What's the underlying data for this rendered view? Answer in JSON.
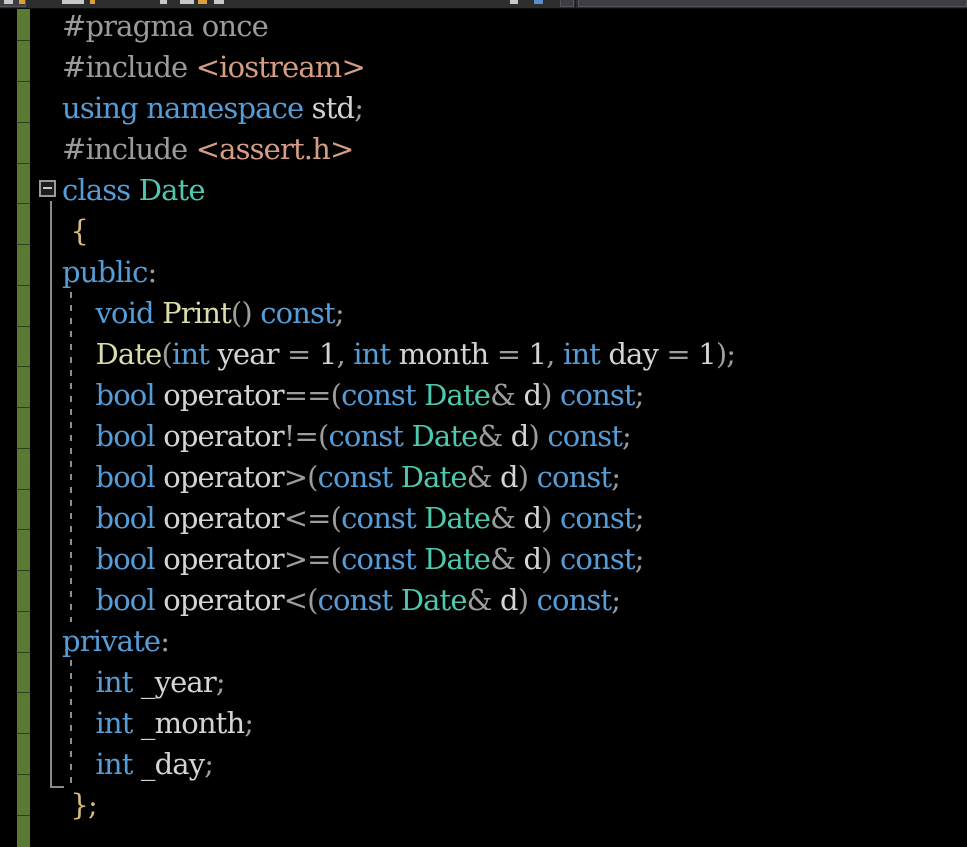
{
  "app": {
    "kind": "code-editor",
    "language": "C++",
    "theme": "dark"
  },
  "colors": {
    "background": "#000000",
    "toolbar": "#2d2d30",
    "change_bar_saved": "#5a7a34",
    "outline_marker": "#9a9a9a",
    "indent_guide": "#8f8f8f",
    "preprocessor": "#9b9b9b",
    "include_path": "#d69d85",
    "keyword": "#569cd6",
    "class_name": "#4ec9b0",
    "function_name": "#dcdcaa",
    "identifier": "#d4d4d4",
    "brace": "#d7ba7d",
    "punctuation": "#9d9d9d",
    "number": "#b5cea8"
  },
  "toolbar": {
    "visible": true,
    "note": "partially cut off at top of screenshot"
  },
  "gutter": {
    "outline_marker_label": "collapse-class-Date",
    "outline_state": "expanded"
  },
  "editor": {
    "line_count": 20,
    "char_width": 17.6,
    "line_height": 41,
    "text_left": 62,
    "lines": [
      {
        "n": 1,
        "text": "#pragma once",
        "tokens": [
          {
            "t": "#pragma once",
            "c": "t-pre"
          }
        ]
      },
      {
        "n": 2,
        "text": "#include <iostream>",
        "tokens": [
          {
            "t": "#include ",
            "c": "t-pre"
          },
          {
            "t": "<iostream>",
            "c": "t-inc"
          }
        ]
      },
      {
        "n": 3,
        "text": "using namespace std;",
        "tokens": [
          {
            "t": "using namespace",
            "c": "t-key"
          },
          {
            "t": " std",
            "c": "t-id"
          },
          {
            "t": ";",
            "c": "t-punc"
          }
        ]
      },
      {
        "n": 4,
        "text": "#include <assert.h>",
        "tokens": [
          {
            "t": "#include ",
            "c": "t-pre"
          },
          {
            "t": "<assert.h>",
            "c": "t-inc"
          }
        ]
      },
      {
        "n": 5,
        "text": "class Date",
        "tokens": [
          {
            "t": "class",
            "c": "t-key"
          },
          {
            "t": " ",
            "c": "t-id"
          },
          {
            "t": "Date",
            "c": "t-type"
          }
        ]
      },
      {
        "n": 6,
        "text": "{",
        "tokens": [
          {
            "t": " ",
            "c": "pad"
          },
          {
            "t": "{",
            "c": "t-brace"
          }
        ]
      },
      {
        "n": 7,
        "text": "public:",
        "tokens": [
          {
            "t": "public",
            "c": "t-key"
          },
          {
            "t": ":",
            "c": "t-punc"
          }
        ]
      },
      {
        "n": 8,
        "text": "    void Print() const;",
        "tokens": [
          {
            "t": "    ",
            "c": "pad"
          },
          {
            "t": "void",
            "c": "t-key"
          },
          {
            "t": " ",
            "c": "t-id"
          },
          {
            "t": "Print",
            "c": "t-fn"
          },
          {
            "t": "()",
            "c": "t-punc"
          },
          {
            "t": " ",
            "c": "t-id"
          },
          {
            "t": "const",
            "c": "t-key"
          },
          {
            "t": ";",
            "c": "t-punc"
          }
        ]
      },
      {
        "n": 9,
        "text": "    Date(int year = 1, int month = 1, int day = 1);",
        "tokens": [
          {
            "t": "    ",
            "c": "pad"
          },
          {
            "t": "Date",
            "c": "t-fn"
          },
          {
            "t": "(",
            "c": "t-punc"
          },
          {
            "t": "int",
            "c": "t-key"
          },
          {
            "t": " year ",
            "c": "t-id"
          },
          {
            "t": "=",
            "c": "t-op"
          },
          {
            "t": " ",
            "c": "t-id"
          },
          {
            "t": "1",
            "c": "t-id"
          },
          {
            "t": ", ",
            "c": "t-punc"
          },
          {
            "t": "int",
            "c": "t-key"
          },
          {
            "t": " month ",
            "c": "t-id"
          },
          {
            "t": "=",
            "c": "t-op"
          },
          {
            "t": " ",
            "c": "t-id"
          },
          {
            "t": "1",
            "c": "t-id"
          },
          {
            "t": ", ",
            "c": "t-punc"
          },
          {
            "t": "int",
            "c": "t-key"
          },
          {
            "t": " day ",
            "c": "t-id"
          },
          {
            "t": "=",
            "c": "t-op"
          },
          {
            "t": " ",
            "c": "t-id"
          },
          {
            "t": "1",
            "c": "t-id"
          },
          {
            "t": ");",
            "c": "t-punc"
          }
        ]
      },
      {
        "n": 10,
        "text": "    bool operator==(const Date& d) const;",
        "tokens": [
          {
            "t": "    ",
            "c": "pad"
          },
          {
            "t": "bool",
            "c": "t-key"
          },
          {
            "t": " operator",
            "c": "t-id"
          },
          {
            "t": "==(",
            "c": "t-punc"
          },
          {
            "t": "const",
            "c": "t-key"
          },
          {
            "t": " ",
            "c": "t-id"
          },
          {
            "t": "Date",
            "c": "t-type"
          },
          {
            "t": "&",
            "c": "t-punc"
          },
          {
            "t": " d",
            "c": "t-id"
          },
          {
            "t": ")",
            "c": "t-punc"
          },
          {
            "t": " ",
            "c": "t-id"
          },
          {
            "t": "const",
            "c": "t-key"
          },
          {
            "t": ";",
            "c": "t-punc"
          }
        ]
      },
      {
        "n": 11,
        "text": "    bool operator!=(const Date& d) const;",
        "tokens": [
          {
            "t": "    ",
            "c": "pad"
          },
          {
            "t": "bool",
            "c": "t-key"
          },
          {
            "t": " operator",
            "c": "t-id"
          },
          {
            "t": "!=(",
            "c": "t-punc"
          },
          {
            "t": "const",
            "c": "t-key"
          },
          {
            "t": " ",
            "c": "t-id"
          },
          {
            "t": "Date",
            "c": "t-type"
          },
          {
            "t": "&",
            "c": "t-punc"
          },
          {
            "t": " d",
            "c": "t-id"
          },
          {
            "t": ")",
            "c": "t-punc"
          },
          {
            "t": " ",
            "c": "t-id"
          },
          {
            "t": "const",
            "c": "t-key"
          },
          {
            "t": ";",
            "c": "t-punc"
          }
        ]
      },
      {
        "n": 12,
        "text": "    bool operator>(const Date& d) const;",
        "tokens": [
          {
            "t": "    ",
            "c": "pad"
          },
          {
            "t": "bool",
            "c": "t-key"
          },
          {
            "t": " operator",
            "c": "t-id"
          },
          {
            "t": ">(",
            "c": "t-punc"
          },
          {
            "t": "const",
            "c": "t-key"
          },
          {
            "t": " ",
            "c": "t-id"
          },
          {
            "t": "Date",
            "c": "t-type"
          },
          {
            "t": "&",
            "c": "t-punc"
          },
          {
            "t": " d",
            "c": "t-id"
          },
          {
            "t": ")",
            "c": "t-punc"
          },
          {
            "t": " ",
            "c": "t-id"
          },
          {
            "t": "const",
            "c": "t-key"
          },
          {
            "t": ";",
            "c": "t-punc"
          }
        ]
      },
      {
        "n": 13,
        "text": "    bool operator<=(const Date& d) const;",
        "tokens": [
          {
            "t": "    ",
            "c": "pad"
          },
          {
            "t": "bool",
            "c": "t-key"
          },
          {
            "t": " operator",
            "c": "t-id"
          },
          {
            "t": "<=(",
            "c": "t-punc"
          },
          {
            "t": "const",
            "c": "t-key"
          },
          {
            "t": " ",
            "c": "t-id"
          },
          {
            "t": "Date",
            "c": "t-type"
          },
          {
            "t": "&",
            "c": "t-punc"
          },
          {
            "t": " d",
            "c": "t-id"
          },
          {
            "t": ")",
            "c": "t-punc"
          },
          {
            "t": " ",
            "c": "t-id"
          },
          {
            "t": "const",
            "c": "t-key"
          },
          {
            "t": ";",
            "c": "t-punc"
          }
        ]
      },
      {
        "n": 14,
        "text": "    bool operator>=(const Date& d) const;",
        "tokens": [
          {
            "t": "    ",
            "c": "pad"
          },
          {
            "t": "bool",
            "c": "t-key"
          },
          {
            "t": " operator",
            "c": "t-id"
          },
          {
            "t": ">=(",
            "c": "t-punc"
          },
          {
            "t": "const",
            "c": "t-key"
          },
          {
            "t": " ",
            "c": "t-id"
          },
          {
            "t": "Date",
            "c": "t-type"
          },
          {
            "t": "&",
            "c": "t-punc"
          },
          {
            "t": " d",
            "c": "t-id"
          },
          {
            "t": ")",
            "c": "t-punc"
          },
          {
            "t": " ",
            "c": "t-id"
          },
          {
            "t": "const",
            "c": "t-key"
          },
          {
            "t": ";",
            "c": "t-punc"
          }
        ]
      },
      {
        "n": 15,
        "text": "    bool operator<(const Date& d) const;",
        "tokens": [
          {
            "t": "    ",
            "c": "pad"
          },
          {
            "t": "bool",
            "c": "t-key"
          },
          {
            "t": " operator",
            "c": "t-id"
          },
          {
            "t": "<(",
            "c": "t-punc"
          },
          {
            "t": "const",
            "c": "t-key"
          },
          {
            "t": " ",
            "c": "t-id"
          },
          {
            "t": "Date",
            "c": "t-type"
          },
          {
            "t": "&",
            "c": "t-punc"
          },
          {
            "t": " d",
            "c": "t-id"
          },
          {
            "t": ")",
            "c": "t-punc"
          },
          {
            "t": " ",
            "c": "t-id"
          },
          {
            "t": "const",
            "c": "t-key"
          },
          {
            "t": ";",
            "c": "t-punc"
          }
        ]
      },
      {
        "n": 16,
        "text": "private:",
        "tokens": [
          {
            "t": "private",
            "c": "t-key"
          },
          {
            "t": ":",
            "c": "t-punc"
          }
        ]
      },
      {
        "n": 17,
        "text": "    int _year;",
        "tokens": [
          {
            "t": "    ",
            "c": "pad"
          },
          {
            "t": "int",
            "c": "t-key"
          },
          {
            "t": " _year",
            "c": "t-id"
          },
          {
            "t": ";",
            "c": "t-punc"
          }
        ]
      },
      {
        "n": 18,
        "text": "    int _month;",
        "tokens": [
          {
            "t": "    ",
            "c": "pad"
          },
          {
            "t": "int",
            "c": "t-key"
          },
          {
            "t": " _month",
            "c": "t-id"
          },
          {
            "t": ";",
            "c": "t-punc"
          }
        ]
      },
      {
        "n": 19,
        "text": "    int _day;",
        "tokens": [
          {
            "t": "    ",
            "c": "pad"
          },
          {
            "t": "int",
            "c": "t-key"
          },
          {
            "t": " _day",
            "c": "t-id"
          },
          {
            "t": ";",
            "c": "t-punc"
          }
        ]
      },
      {
        "n": 20,
        "text": "};",
        "tokens": [
          {
            "t": " ",
            "c": "pad"
          },
          {
            "t": "}",
            "c": "t-brace"
          },
          {
            "t": ";",
            "c": "t-brace"
          }
        ]
      }
    ]
  }
}
